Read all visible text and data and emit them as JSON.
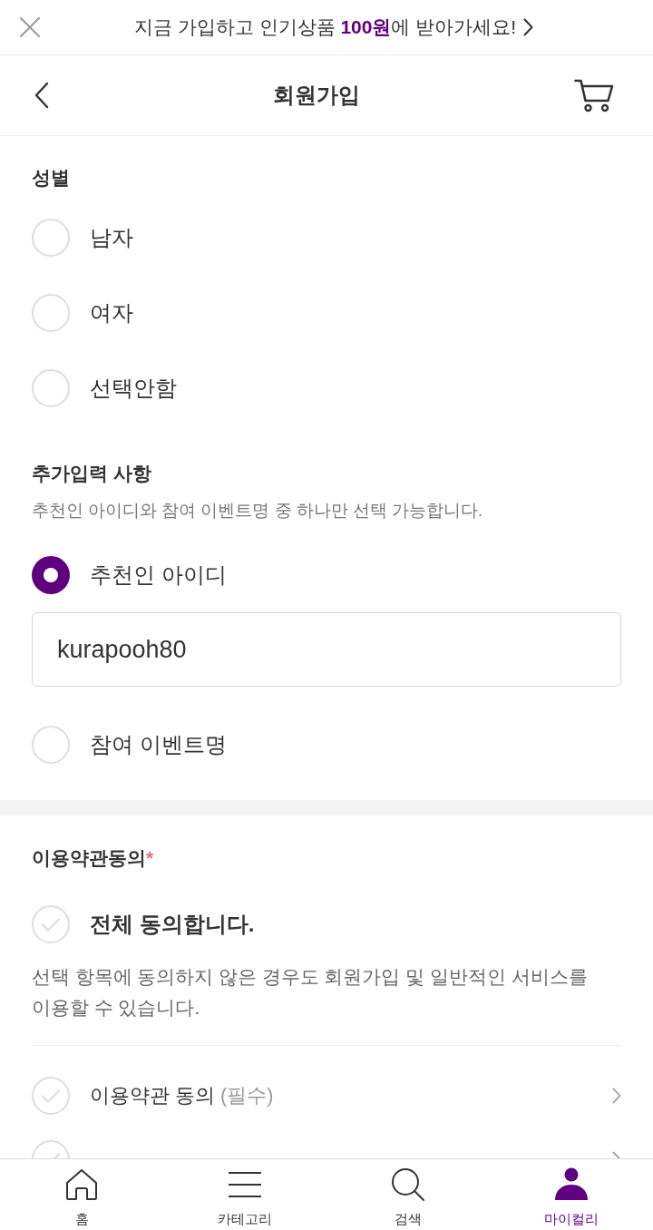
{
  "promo_banner": {
    "text": "지금 가입하고 인기상품 **100원**에 받아가세요!"
  },
  "header": {
    "title": "회원가입"
  },
  "gender": {
    "title": "성별",
    "options": [
      {
        "label": "남자",
        "selected": false
      },
      {
        "label": "여자",
        "selected": false
      },
      {
        "label": "선택안함",
        "selected": false
      }
    ]
  },
  "additional_input": {
    "title": "추가입력 사항",
    "description": "추천인 아이디와 참여 이벤트명 중 하나만 선택 가능합니다.",
    "options": [
      {
        "label": "추천인 아이디",
        "selected": true,
        "value": "kurapooh80"
      },
      {
        "label": "참여 이벤트명",
        "selected": false
      }
    ]
  },
  "terms": {
    "title": "이용약관동의",
    "required_mark": "*",
    "agree_all": {
      "label": "전체 동의합니다.",
      "checked": false
    },
    "notice": "선택 항목에 동의하지 않은 경우도 회원가입 및 일반적인 서비스를 이용할 수 있습니다.",
    "items": [
      {
        "label": "이용약관 동의",
        "note": "(필수)",
        "checked": false
      },
      {
        "checked": false
      }
    ]
  },
  "bottom_nav": {
    "items": [
      {
        "kind": "home",
        "label": "홈",
        "selected": false
      },
      {
        "kind": "category",
        "label": "카테고리",
        "selected": false
      },
      {
        "kind": "search",
        "label": "검색",
        "selected": false
      },
      {
        "kind": "my",
        "label": "마이컬리",
        "selected": true
      }
    ]
  }
}
